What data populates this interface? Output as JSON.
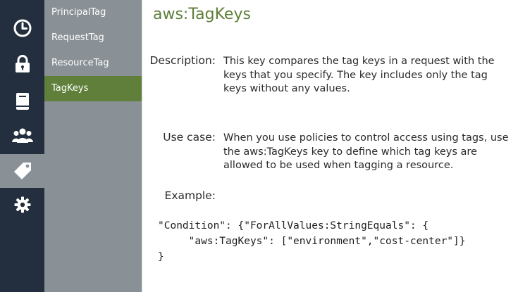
{
  "rail": {
    "items": [
      {
        "icon": "clock-icon",
        "active": false
      },
      {
        "icon": "lock-icon",
        "active": false
      },
      {
        "icon": "book-icon",
        "active": false
      },
      {
        "icon": "users-icon",
        "active": false
      },
      {
        "icon": "tag-icon",
        "active": true
      },
      {
        "icon": "gear-icon",
        "active": false
      }
    ]
  },
  "subnav": {
    "items": [
      {
        "label": "PrincipalTag",
        "active": false
      },
      {
        "label": "RequestTag",
        "active": false
      },
      {
        "label": "ResourceTag",
        "active": false
      },
      {
        "label": "TagKeys",
        "active": true
      }
    ]
  },
  "main": {
    "title": "aws:TagKeys",
    "description_label": "Description:",
    "description_text": "This key compares the tag keys in a request with the keys that you specify. The key includes only the tag keys without any values.",
    "usecase_label": "Use case:",
    "usecase_text": "When you use policies to control access using tags, use the aws:TagKeys key to define which tag keys are allowed to be used when tagging a resource.",
    "example_label": "Example:",
    "example_code": "\"Condition\": {\"ForAllValues:StringEquals\": {\n     \"aws:TagKeys\": [\"environment\",\"cost-center\"]}\n}"
  },
  "colors": {
    "rail_bg": "#232f3e",
    "subnav_bg": "#8a9196",
    "accent_green": "#5f7f3a",
    "icon_white": "#ffffff"
  }
}
